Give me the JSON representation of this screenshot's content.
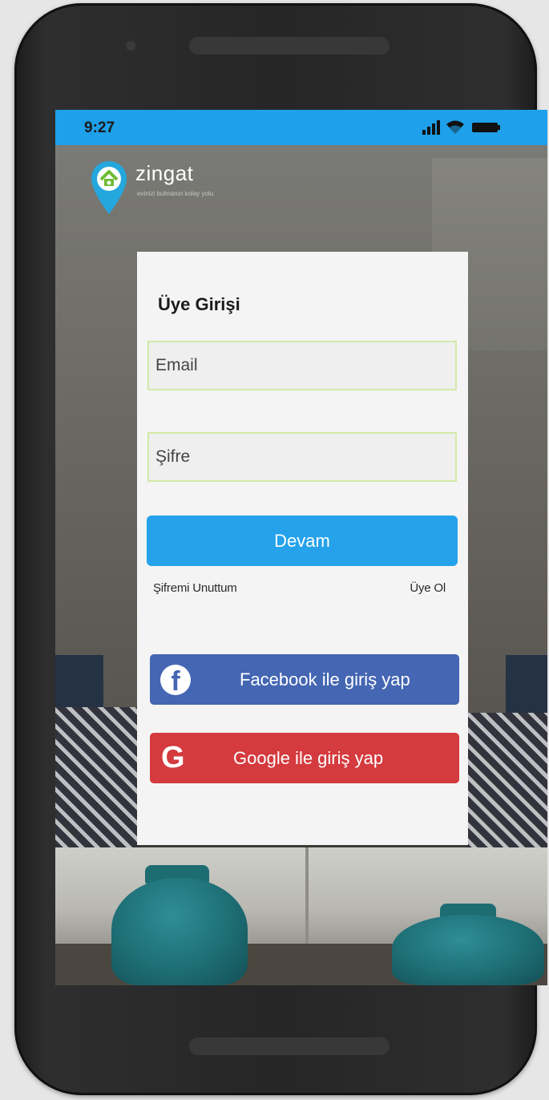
{
  "status_bar": {
    "time": "9:27",
    "signal_icon": "signal-icon",
    "wifi_icon": "wifi-icon",
    "battery_icon": "battery-icon",
    "color": "#1ea0ea"
  },
  "brand": {
    "name": "zingat",
    "tagline": "evinizi bulmanın kolay yolu",
    "color": "#24a7dd"
  },
  "login": {
    "title": "Üye Girişi",
    "email_placeholder": "Email",
    "password_placeholder": "Şifre",
    "continue_label": "Devam",
    "forgot_password": "Şifremi Unuttum",
    "register": "Üye Ol"
  },
  "social": {
    "facebook_label": "Facebook ile giriş yap",
    "facebook_icon": "facebook-icon",
    "facebook_color": "#4466b3",
    "google_label": "Google ile giriş yap",
    "google_icon": "google-icon",
    "google_color": "#d43a3e"
  }
}
